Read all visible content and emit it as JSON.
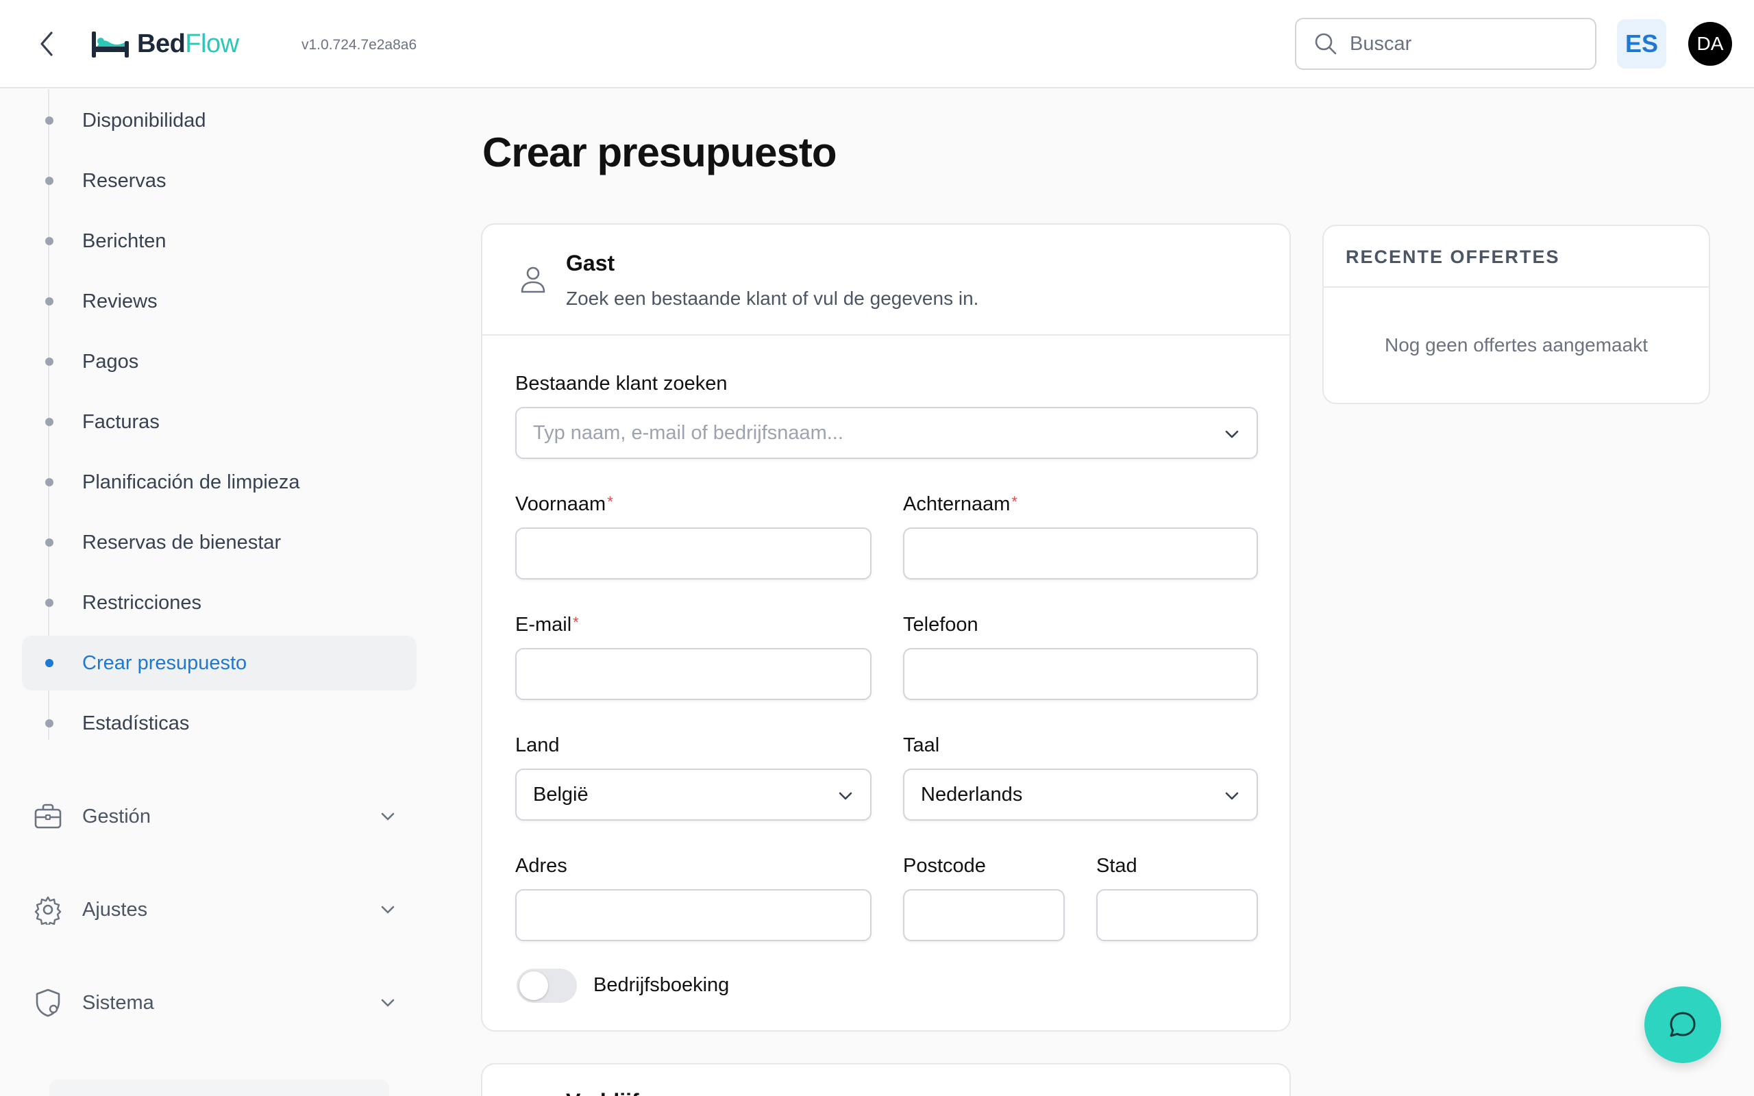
{
  "header": {
    "logo_bed": "Bed",
    "logo_flow": "Flow",
    "version": "v1.0.724.7e2a8a6",
    "search_placeholder": "Buscar",
    "language": "ES",
    "avatar_initials": "DA"
  },
  "sidebar": {
    "items": [
      {
        "label": "Disponibilidad"
      },
      {
        "label": "Reservas"
      },
      {
        "label": "Berichten"
      },
      {
        "label": "Reviews"
      },
      {
        "label": "Pagos"
      },
      {
        "label": "Facturas"
      },
      {
        "label": "Planificación de limpieza"
      },
      {
        "label": "Reservas de bienestar"
      },
      {
        "label": "Restricciones"
      },
      {
        "label": "Crear presupuesto",
        "active": true
      },
      {
        "label": "Estadísticas"
      }
    ],
    "groups": [
      {
        "label": "Gestión",
        "icon": "briefcase-icon"
      },
      {
        "label": "Ajustes",
        "icon": "gear-icon"
      },
      {
        "label": "Sistema",
        "icon": "shield-gear-icon"
      }
    ]
  },
  "main": {
    "title": "Crear presupuesto",
    "guest_card": {
      "title": "Gast",
      "subtitle": "Zoek een bestaande klant of vul de gegevens in.",
      "search_label": "Bestaande klant zoeken",
      "search_placeholder": "Typ naam, e-mail of bedrijfsnaam...",
      "first_name_label": "Voornaam",
      "last_name_label": "Achternaam",
      "email_label": "E-mail",
      "phone_label": "Telefoon",
      "country_label": "Land",
      "country_value": "België",
      "language_label": "Taal",
      "language_value": "Nederlands",
      "address_label": "Adres",
      "postcode_label": "Postcode",
      "city_label": "Stad",
      "required_mark": "*",
      "business_toggle_label": "Bedrijfsboeking",
      "business_toggle_on": false
    },
    "second_card_title": "Verblijf"
  },
  "recent": {
    "title": "RECENTE OFFERTES",
    "empty": "Nog geen offertes aangemaakt"
  },
  "colors": {
    "accent": "#1f78d1",
    "brand_teal": "#2dc7b8",
    "chat_button": "#2dd4bf",
    "required": "#ef4444"
  }
}
